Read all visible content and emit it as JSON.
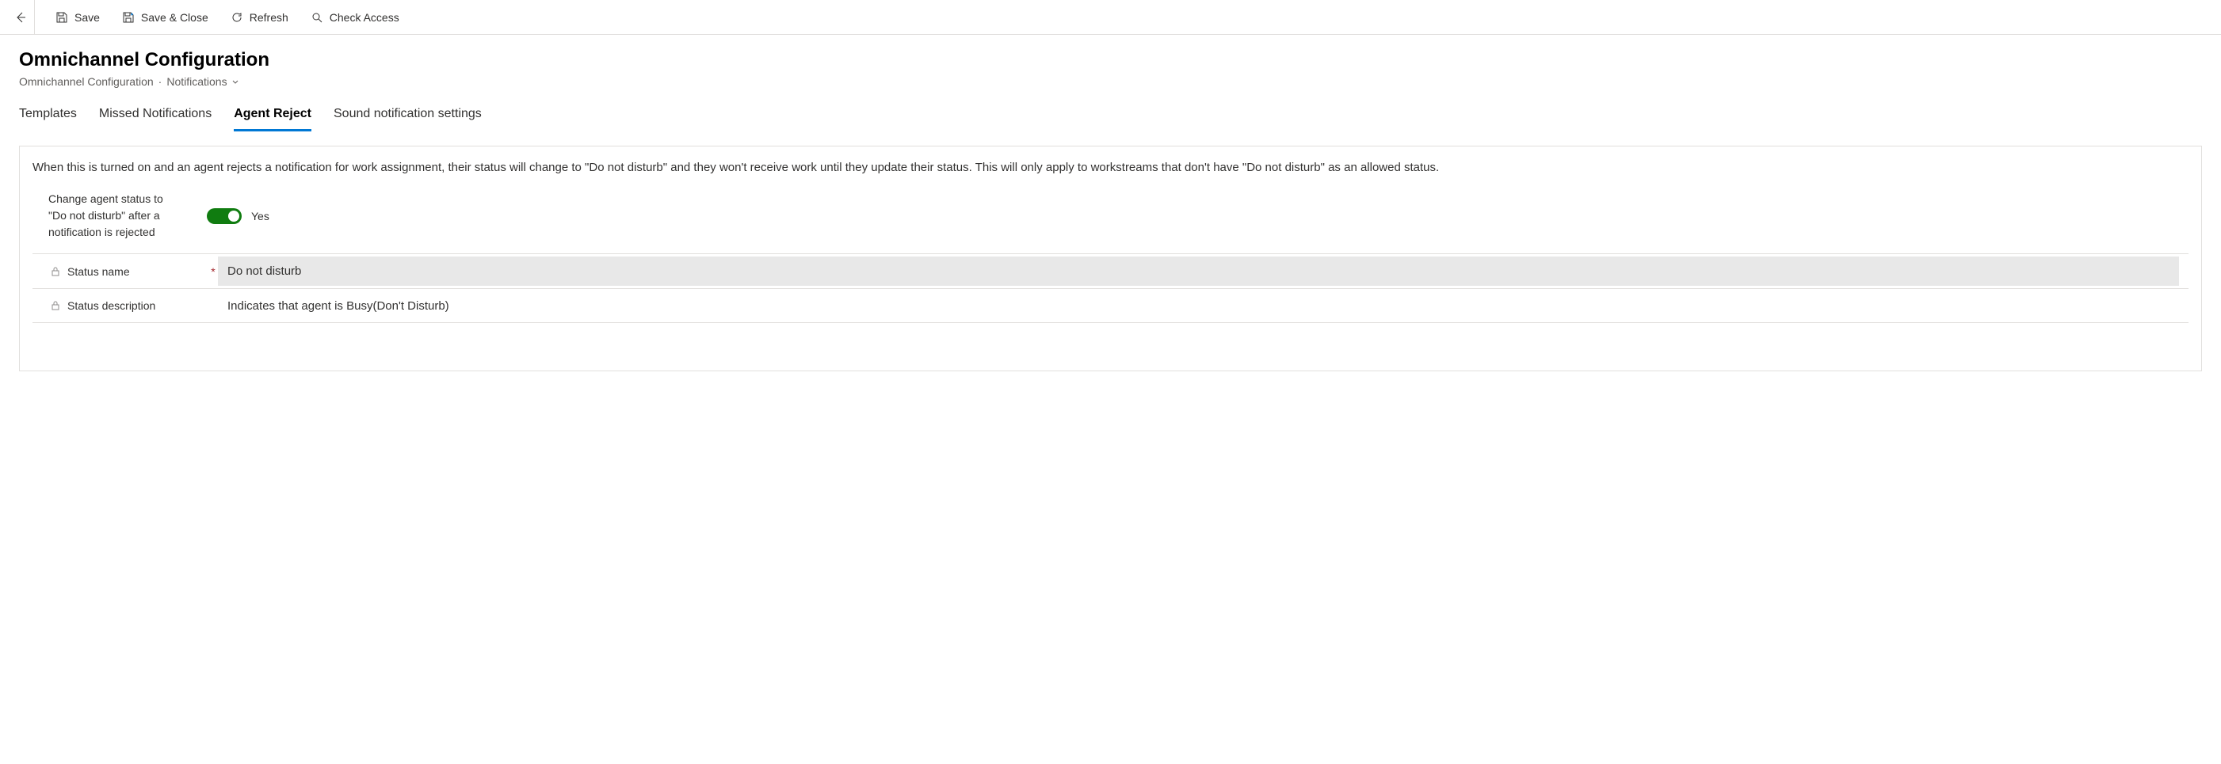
{
  "toolbar": {
    "save": "Save",
    "save_close": "Save & Close",
    "refresh": "Refresh",
    "check_access": "Check Access"
  },
  "header": {
    "title": "Omnichannel Configuration",
    "breadcrumb": {
      "entity": "Omnichannel Configuration",
      "view": "Notifications"
    }
  },
  "tabs": [
    {
      "label": "Templates",
      "active": false
    },
    {
      "label": "Missed Notifications",
      "active": false
    },
    {
      "label": "Agent Reject",
      "active": true
    },
    {
      "label": "Sound notification settings",
      "active": false
    }
  ],
  "content": {
    "description": "When this is turned on and an agent rejects a notification for work assignment, their status will change to \"Do not disturb\" and they won't receive work until they update their status. This will only apply to workstreams that don't have \"Do not disturb\" as an allowed status.",
    "toggle": {
      "label": "Change agent status to \"Do not disturb\" after a notification is rejected",
      "value": "Yes",
      "on": true
    },
    "fields": {
      "status_name": {
        "label": "Status name",
        "required": true,
        "locked": true,
        "value": "Do not disturb"
      },
      "status_description": {
        "label": "Status description",
        "required": false,
        "locked": true,
        "value": "Indicates that agent is Busy(Don't Disturb)"
      }
    }
  }
}
